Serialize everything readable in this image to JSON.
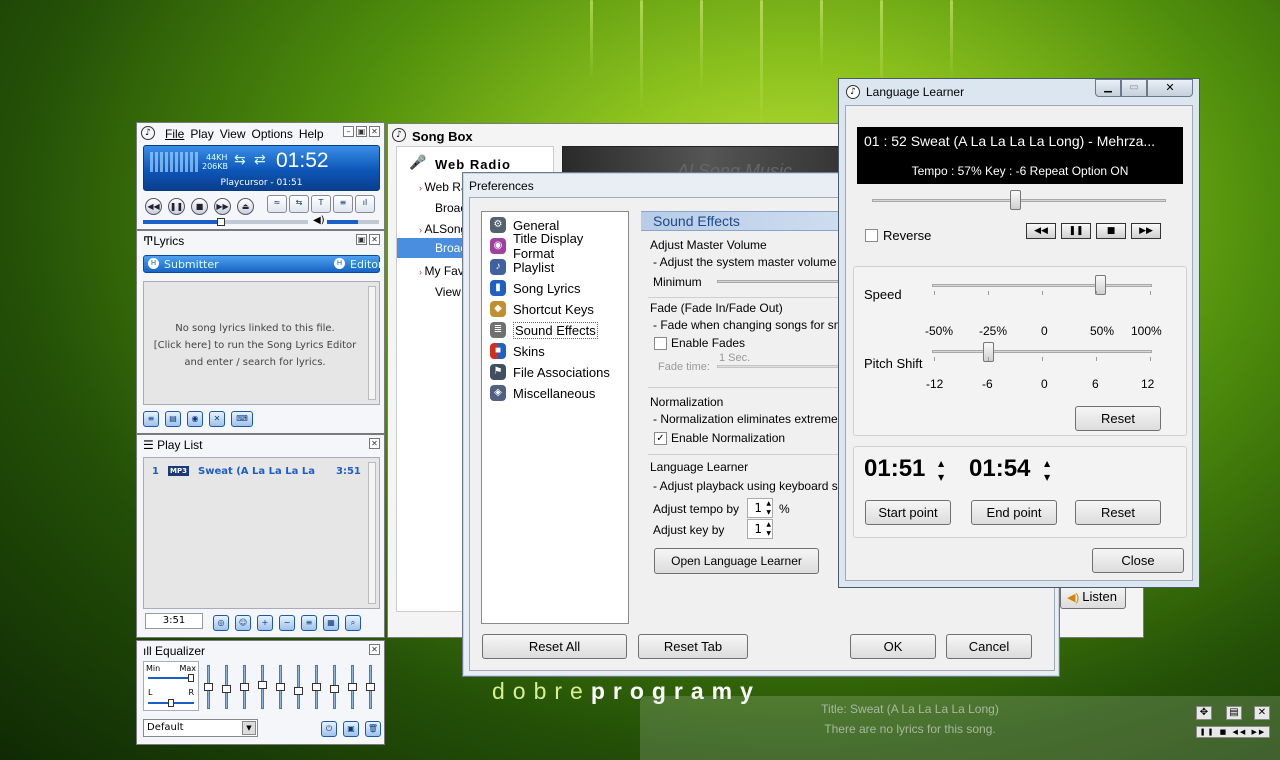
{
  "desktop": {
    "watermark_left": "dobre",
    "watermark_right": "programy"
  },
  "player": {
    "menu": [
      "File",
      "Play",
      "View",
      "Options",
      "Help"
    ],
    "khz": "44KH",
    "kbps": "206KB",
    "time": "01:52",
    "cursor_text": "Playcursor - 01:51",
    "lyrics": {
      "title": "Lyrics",
      "submitter": "Submitter",
      "editor": "Editor",
      "message_line1": "No song lyrics linked to this file.",
      "message_line2": "[Click here] to run the Song Lyrics Editor",
      "message_line3": "and enter / search for lyrics."
    },
    "playlist": {
      "title": "Play List",
      "item_num": "1",
      "item_badge": "MP3",
      "item_title": "Sweat (A La La La La Lo",
      "item_time": "3:51",
      "total_time": "3:51"
    },
    "equalizer": {
      "title": "Equalizer",
      "min": "Min",
      "max": "Max",
      "left": "L",
      "right": "R",
      "preset": "Default",
      "levels": [
        0.5,
        0.45,
        0.5,
        0.55,
        0.5,
        0.4,
        0.5,
        0.45,
        0.5,
        0.5
      ]
    }
  },
  "songbox": {
    "title": "Song Box",
    "web_radio": "Web Radio",
    "tree": [
      "Web Ra",
      "Broac",
      "ALSong",
      "Broac",
      "My Fav",
      "View"
    ],
    "listen": "Listen",
    "banner": "Al Song Music"
  },
  "preferences": {
    "title": "Preferences",
    "items": [
      {
        "label": "General",
        "color": "#556070"
      },
      {
        "label": "Title Display Format",
        "color": "#a040a0"
      },
      {
        "label": "Playlist",
        "color": "#4060a0"
      },
      {
        "label": "Song Lyrics",
        "color": "#2060c0"
      },
      {
        "label": "Shortcut Keys",
        "color": "#c09030"
      },
      {
        "label": "Sound Effects",
        "color": "#707070"
      },
      {
        "label": "Skins",
        "color": "#d03020"
      },
      {
        "label": "File Associations",
        "color": "#405060"
      },
      {
        "label": "Miscellaneous",
        "color": "#506080"
      }
    ],
    "section_header": "Sound Effects",
    "master_volume_title": "Adjust Master Volume",
    "master_volume_desc": "- Adjust the system master volume for th",
    "minimum": "Minimum",
    "fade_title": "Fade (Fade In/Fade Out)",
    "fade_desc": "- Fade when changing songs for smooth",
    "enable_fades": "Enable Fades",
    "fade_value": "1 Sec.",
    "fade_time": "Fade time:",
    "normalization_title": "Normalization",
    "normalization_desc": "- Normalization eliminates extreme volun",
    "enable_normalization": "Enable Normalization",
    "lang_title": "Language Learner",
    "lang_desc": "- Adjust playback using keyboard shortc",
    "adjust_tempo": "Adjust tempo by",
    "tempo_value": "1",
    "percent": "%",
    "adjust_key": "Adjust key by",
    "key_value": "1",
    "open_lang": "Open Language Learner",
    "reset_all": "Reset All",
    "reset_tab": "Reset Tab",
    "ok": "OK",
    "cancel": "Cancel"
  },
  "learner": {
    "title": "Language Learner",
    "display_line": "01 : 52   Sweat (A La La La La Long) - Mehrza...",
    "tempo_line": "Tempo : 57%  Key : -6   Repeat Option ON",
    "reverse": "Reverse",
    "speed": "Speed",
    "speed_ticks": [
      "-50%",
      "-25%",
      "0",
      "50%",
      "100%"
    ],
    "pitch": "Pitch Shift",
    "pitch_ticks": [
      "-12",
      "-6",
      "0",
      "6",
      "12"
    ],
    "reset": "Reset",
    "start_time": "01:51",
    "end_time": "01:54",
    "start_point": "Start point",
    "end_point": "End point",
    "reset2": "Reset",
    "close": "Close"
  },
  "notifier": {
    "title_line": "Title: Sweat (A La La La La Long)",
    "lyrics_line": "There are no lyrics for this song."
  }
}
